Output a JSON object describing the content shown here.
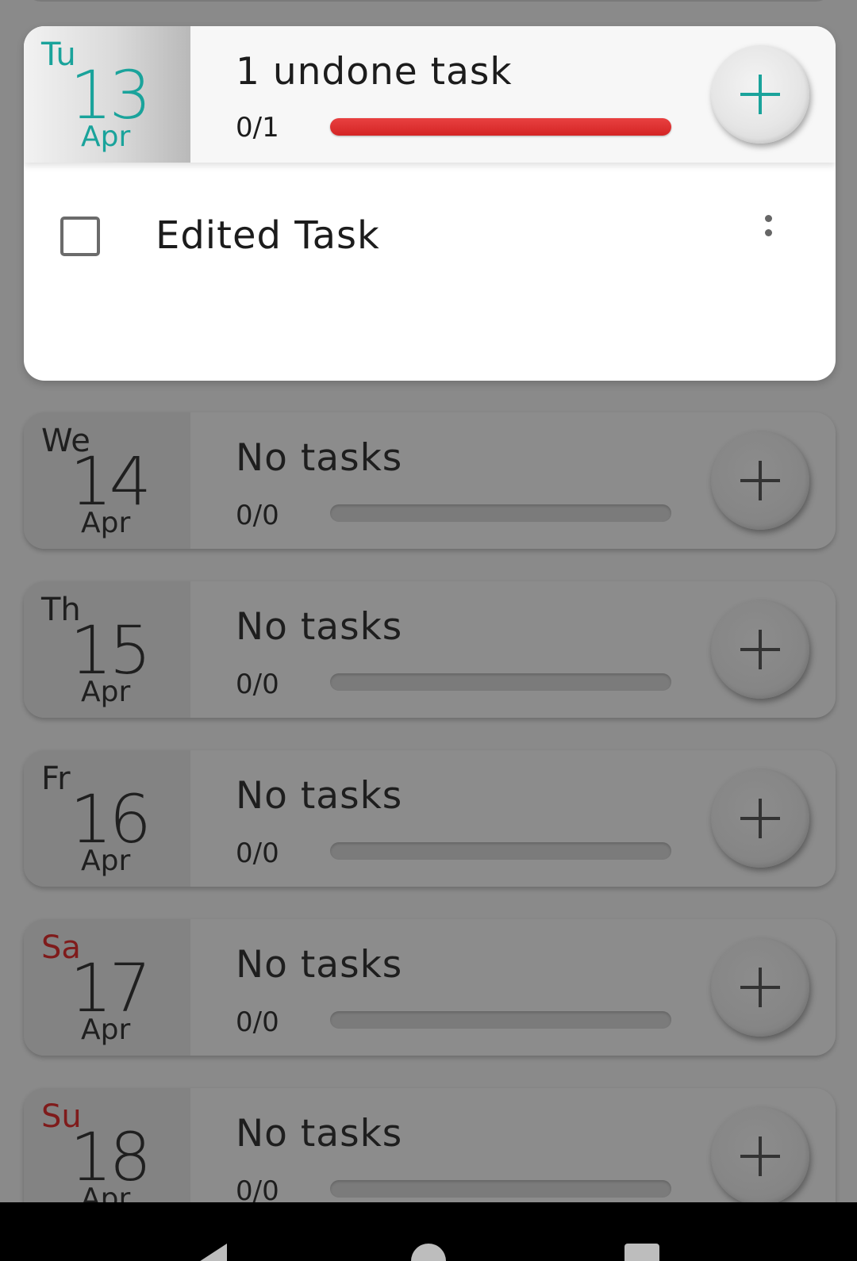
{
  "expanded_day": {
    "dow": "Tu",
    "day": "13",
    "month": "Apr",
    "title": "1 undone task",
    "count": "0/1",
    "progress": 0,
    "tasks": [
      {
        "label": "Edited Task",
        "done": false
      }
    ]
  },
  "days": [
    {
      "dow": "We",
      "day": "14",
      "month": "Apr",
      "title": "No tasks",
      "count": "0/0",
      "weekend": false
    },
    {
      "dow": "Th",
      "day": "15",
      "month": "Apr",
      "title": "No tasks",
      "count": "0/0",
      "weekend": false
    },
    {
      "dow": "Fr",
      "day": "16",
      "month": "Apr",
      "title": "No tasks",
      "count": "0/0",
      "weekend": false
    },
    {
      "dow": "Sa",
      "day": "17",
      "month": "Apr",
      "title": "No tasks",
      "count": "0/0",
      "weekend": true
    },
    {
      "dow": "Su",
      "day": "18",
      "month": "Apr",
      "title": "No tasks",
      "count": "0/0",
      "weekend": true
    }
  ],
  "colors": {
    "accent": "#1aa39b",
    "progress_bar": "#e02f2f",
    "weekend": "#7f1b1b"
  },
  "icons": {
    "add": "plus-icon",
    "task_menu": "more-vert-icon",
    "task_check": "checkbox-icon",
    "nav_back": "nav-back-icon",
    "nav_home": "nav-home-icon",
    "nav_recents": "nav-recents-icon"
  }
}
